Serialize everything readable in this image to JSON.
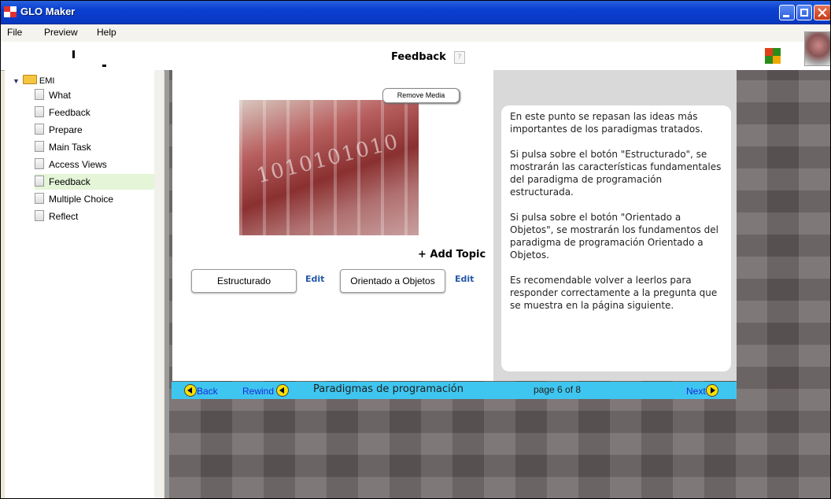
{
  "window": {
    "title": "GLO Maker",
    "controls": [
      "minimize-icon",
      "maximize-icon",
      "close-icon"
    ]
  },
  "menu": {
    "items": [
      "File",
      "Preview",
      "Help"
    ]
  },
  "header": {
    "title": "Feedback"
  },
  "tree": {
    "root": "EMI",
    "items": [
      {
        "label": "What"
      },
      {
        "label": "Feedback"
      },
      {
        "label": "Prepare"
      },
      {
        "label": "Main Task"
      },
      {
        "label": "Access Views"
      },
      {
        "label": "Feedback",
        "selected": true
      },
      {
        "label": "Multiple Choice"
      },
      {
        "label": "Reflect"
      }
    ]
  },
  "media": {
    "remove_label": "Remove Media",
    "image_text": "1010101010"
  },
  "topics": {
    "add_label": "+ Add Topic",
    "buttons": [
      {
        "label": "Estructurado",
        "edit": "Edit"
      },
      {
        "label": "Orientado a Objetos",
        "edit": "Edit"
      }
    ]
  },
  "description": {
    "paragraphs": [
      "En este punto se repasan las ideas más importantes de los paradigmas tratados.",
      "Si pulsa sobre el botón \"Estructurado\", se mostrarán las características fundamentales del paradigma de programación estructurada.",
      "Si pulsa sobre el botón \"Orientado a Objetos\", se mostrarán los fundamentos del paradigma de programación Orientado a Objetos.",
      "Es recomendable volver a leerlos para responder correctamente a la pregunta que se muestra en la página siguiente."
    ]
  },
  "navigation": {
    "back": "Back",
    "rewind": "Rewind",
    "course_title": "Paradigmas de programación",
    "page_indicator": "page 6 of 8",
    "next": "Next"
  },
  "colors": {
    "titlebar": "#0a3fd0",
    "navbar": "#3fc6f0",
    "selected_item": "#e4f5d8",
    "edit_link": "#2457a8"
  }
}
